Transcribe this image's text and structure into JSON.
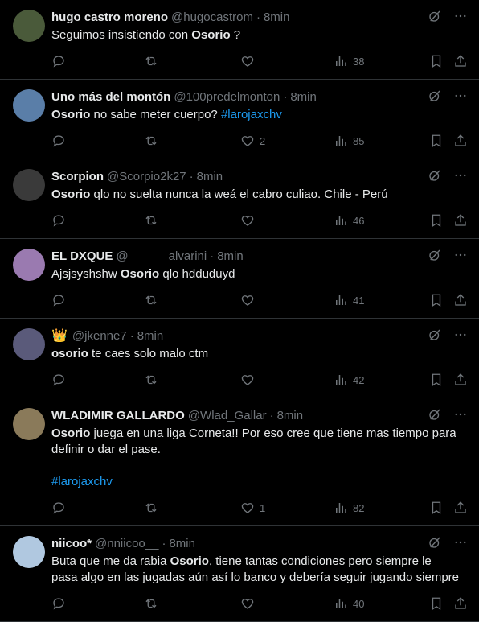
{
  "tweets": [
    {
      "name": "hugo castro moreno",
      "handle": "@hugocastrom",
      "time": "8min",
      "text_pre": "Seguimos insistiendo con ",
      "bold": "Osorio",
      "text_post": " ?",
      "hashtag": "",
      "hashtag_line": "",
      "likes": "",
      "views": "38",
      "avatar_color": "#4a5a3a"
    },
    {
      "name": "Uno más del montón",
      "handle": "@100predelmonton",
      "time": "8min",
      "text_pre": "",
      "bold": "Osorio",
      "text_post": " no sabe meter cuerpo? ",
      "hashtag": "#larojaxchv",
      "hashtag_line": "",
      "likes": "2",
      "views": "85",
      "avatar_color": "#5a7ea8"
    },
    {
      "name": "Scorpion",
      "handle": "@Scorpio2k27",
      "time": "8min",
      "text_pre": "",
      "bold": "Osorio",
      "text_post": " qlo no suelta nunca la weá el cabro culiao. Chile - Perú",
      "hashtag": "",
      "hashtag_line": "",
      "likes": "",
      "views": "46",
      "avatar_color": "#3a3a3a"
    },
    {
      "name": "EL DXQUE",
      "handle": "@______alvarini",
      "time": "8min",
      "text_pre": "Ajsjsyshshw ",
      "bold": "Osorio",
      "text_post": " qlo hdduduyd",
      "hashtag": "",
      "hashtag_line": "",
      "likes": "",
      "views": "41",
      "avatar_color": "#9a7ab0"
    },
    {
      "name": "",
      "handle": "@jkenne7",
      "time": "8min",
      "text_pre": "",
      "bold": "osorio",
      "text_post": " te caes solo malo ctm",
      "hashtag": "",
      "hashtag_line": "",
      "likes": "",
      "views": "42",
      "avatar_color": "#5a5a7a"
    },
    {
      "name": "WLADIMIR GALLARDO",
      "handle": "@Wlad_Gallar",
      "time": "8min",
      "text_pre": "",
      "bold": "Osorio",
      "text_post": " juega en una liga Corneta!! Por eso cree que tiene mas tiempo para\ndefinir o dar el pase.",
      "hashtag": "",
      "hashtag_line": "#larojaxchv",
      "likes": "1",
      "views": "82",
      "avatar_color": "#8a7a5a"
    },
    {
      "name": "niicoo*",
      "handle": "@nniicoo__",
      "time": "8min",
      "text_pre": "Buta que me da rabia ",
      "bold": "Osorio",
      "text_post": ", tiene tantas condiciones pero siempre le\npasa algo en las jugadas aún así lo banco y debería seguir jugando siempre",
      "hashtag": "",
      "hashtag_line": "",
      "likes": "",
      "views": "40",
      "avatar_color": "#b0c8e0"
    }
  ],
  "meta": {
    "dot": "·",
    "crown": "👑"
  }
}
